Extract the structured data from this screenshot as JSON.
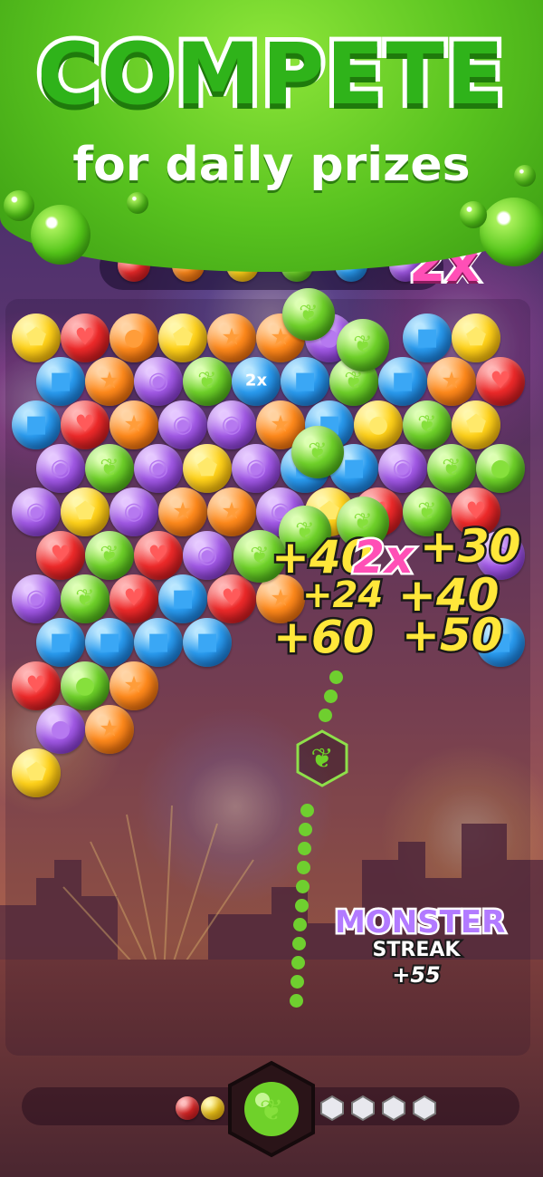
{
  "banner": {
    "title": "COMPETE",
    "subtitle": "for daily prizes"
  },
  "multiplier": "2x",
  "board_badge": "2x",
  "tray_colors": [
    "red",
    "orange",
    "yellow",
    "green",
    "blue",
    "purple"
  ],
  "bubbles": [
    {
      "r": 0,
      "c": 0,
      "color": "yellow",
      "icon": "pentagon"
    },
    {
      "r": 0,
      "c": 1,
      "color": "red",
      "icon": "heart"
    },
    {
      "r": 0,
      "c": 2,
      "color": "orange",
      "icon": "bomb"
    },
    {
      "r": 0,
      "c": 3,
      "color": "yellow",
      "icon": "pentagon"
    },
    {
      "r": 0,
      "c": 4,
      "color": "orange",
      "icon": "star"
    },
    {
      "r": 0,
      "c": 5,
      "color": "orange",
      "icon": "star"
    },
    {
      "r": 0,
      "c": 6,
      "color": "purple",
      "icon": "bomb"
    },
    {
      "r": 0,
      "c": 8,
      "color": "blue",
      "icon": "square"
    },
    {
      "r": 0,
      "c": 9,
      "color": "yellow",
      "icon": "pentagon"
    },
    {
      "r": 1,
      "c": 0,
      "color": "blue",
      "icon": "square"
    },
    {
      "r": 1,
      "c": 1,
      "color": "orange",
      "icon": "star"
    },
    {
      "r": 1,
      "c": 2,
      "color": "purple",
      "icon": "ring"
    },
    {
      "r": 1,
      "c": 3,
      "color": "green",
      "icon": "leaf"
    },
    {
      "r": 1,
      "c": 4,
      "color": "blue",
      "icon": "badge"
    },
    {
      "r": 1,
      "c": 5,
      "color": "blue",
      "icon": "square"
    },
    {
      "r": 1,
      "c": 6,
      "color": "green",
      "icon": "leaf"
    },
    {
      "r": 1,
      "c": 7,
      "color": "blue",
      "icon": "square"
    },
    {
      "r": 1,
      "c": 8,
      "color": "orange",
      "icon": "star"
    },
    {
      "r": 1,
      "c": 9,
      "color": "red",
      "icon": "heart"
    },
    {
      "r": 2,
      "c": 0,
      "color": "blue",
      "icon": "square"
    },
    {
      "r": 2,
      "c": 1,
      "color": "red",
      "icon": "heart"
    },
    {
      "r": 2,
      "c": 2,
      "color": "orange",
      "icon": "star"
    },
    {
      "r": 2,
      "c": 3,
      "color": "purple",
      "icon": "ring"
    },
    {
      "r": 2,
      "c": 4,
      "color": "purple",
      "icon": "ring"
    },
    {
      "r": 2,
      "c": 5,
      "color": "orange",
      "icon": "star"
    },
    {
      "r": 2,
      "c": 6,
      "color": "blue",
      "icon": "square"
    },
    {
      "r": 2,
      "c": 7,
      "color": "yellow",
      "icon": "bomb"
    },
    {
      "r": 2,
      "c": 8,
      "color": "green",
      "icon": "leaf"
    },
    {
      "r": 2,
      "c": 9,
      "color": "yellow",
      "icon": "pentagon"
    },
    {
      "r": 3,
      "c": 0,
      "color": "purple",
      "icon": "ring"
    },
    {
      "r": 3,
      "c": 1,
      "color": "green",
      "icon": "leaf"
    },
    {
      "r": 3,
      "c": 2,
      "color": "purple",
      "icon": "ring"
    },
    {
      "r": 3,
      "c": 3,
      "color": "yellow",
      "icon": "pentagon"
    },
    {
      "r": 3,
      "c": 4,
      "color": "purple",
      "icon": "ring"
    },
    {
      "r": 3,
      "c": 5,
      "color": "blue",
      "icon": "square"
    },
    {
      "r": 3,
      "c": 6,
      "color": "blue",
      "icon": "square"
    },
    {
      "r": 3,
      "c": 7,
      "color": "purple",
      "icon": "ring"
    },
    {
      "r": 3,
      "c": 8,
      "color": "green",
      "icon": "leaf"
    },
    {
      "r": 3,
      "c": 9,
      "color": "green",
      "icon": "bomb"
    },
    {
      "r": 4,
      "c": 0,
      "color": "purple",
      "icon": "ring"
    },
    {
      "r": 4,
      "c": 1,
      "color": "yellow",
      "icon": "pentagon"
    },
    {
      "r": 4,
      "c": 2,
      "color": "purple",
      "icon": "ring"
    },
    {
      "r": 4,
      "c": 3,
      "color": "orange",
      "icon": "star"
    },
    {
      "r": 4,
      "c": 4,
      "color": "orange",
      "icon": "star"
    },
    {
      "r": 4,
      "c": 5,
      "color": "purple",
      "icon": "ring"
    },
    {
      "r": 4,
      "c": 6,
      "color": "yellow",
      "icon": "pentagon"
    },
    {
      "r": 4,
      "c": 7,
      "color": "red",
      "icon": "heart"
    },
    {
      "r": 4,
      "c": 8,
      "color": "green",
      "icon": "leaf"
    },
    {
      "r": 4,
      "c": 9,
      "color": "red",
      "icon": "heart"
    },
    {
      "r": 5,
      "c": 0,
      "color": "red",
      "icon": "heart"
    },
    {
      "r": 5,
      "c": 1,
      "color": "green",
      "icon": "leaf"
    },
    {
      "r": 5,
      "c": 2,
      "color": "red",
      "icon": "heart"
    },
    {
      "r": 5,
      "c": 3,
      "color": "purple",
      "icon": "ring"
    },
    {
      "r": 5,
      "c": 9,
      "color": "purple",
      "icon": "ring"
    },
    {
      "r": 6,
      "c": 0,
      "color": "purple",
      "icon": "ring"
    },
    {
      "r": 6,
      "c": 1,
      "color": "green",
      "icon": "leaf"
    },
    {
      "r": 6,
      "c": 2,
      "color": "red",
      "icon": "heart"
    },
    {
      "r": 6,
      "c": 3,
      "color": "blue",
      "icon": "square"
    },
    {
      "r": 6,
      "c": 4,
      "color": "red",
      "icon": "heart"
    },
    {
      "r": 6,
      "c": 5,
      "color": "orange",
      "icon": "star"
    },
    {
      "r": 7,
      "c": 0,
      "color": "blue",
      "icon": "square"
    },
    {
      "r": 7,
      "c": 1,
      "color": "blue",
      "icon": "square"
    },
    {
      "r": 7,
      "c": 2,
      "color": "blue",
      "icon": "square"
    },
    {
      "r": 7,
      "c": 3,
      "color": "blue",
      "icon": "square"
    },
    {
      "r": 7,
      "c": 9,
      "color": "blue",
      "icon": "square"
    },
    {
      "r": 8,
      "c": 0,
      "color": "red",
      "icon": "heart"
    },
    {
      "r": 8,
      "c": 1,
      "color": "green",
      "icon": "bomb"
    },
    {
      "r": 8,
      "c": 2,
      "color": "orange",
      "icon": "star"
    },
    {
      "r": 9,
      "c": 0,
      "color": "purple",
      "icon": "bomb"
    },
    {
      "r": 9,
      "c": 1,
      "color": "orange",
      "icon": "star"
    },
    {
      "r": 10,
      "c": 0,
      "color": "yellow",
      "icon": "pentagon"
    }
  ],
  "scores": [
    "+40",
    "2x",
    "+30",
    "+24",
    "+40",
    "+60",
    "+50"
  ],
  "streak": {
    "title": "MONSTER",
    "subtitle": "STREAK",
    "points": "+55"
  },
  "shooter": {
    "current_color": "green",
    "queue_colors": [
      "red",
      "yellow"
    ],
    "gem_count": 4
  },
  "colors": {
    "yellow": "#ffd21a",
    "red": "#ee2a2a",
    "orange": "#ff8a1c",
    "blue": "#2a9cf0",
    "purple": "#a25ae6",
    "green": "#6fd12a"
  }
}
